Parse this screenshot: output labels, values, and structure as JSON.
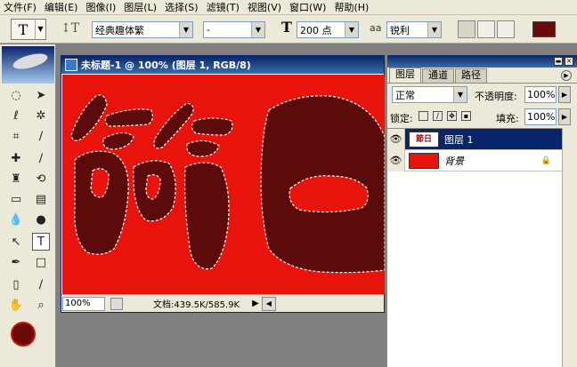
{
  "menu": [
    "文件(F)",
    "编辑(E)",
    "图像(I)",
    "图层(L)",
    "选择(S)",
    "滤镜(T)",
    "视图(V)",
    "窗口(W)",
    "帮助(H)"
  ],
  "options": {
    "font_family": "经典趣体繁",
    "font_style": "-",
    "font_size": "200 点",
    "antialias_icon": "aa",
    "antialias": "锐利",
    "text_color": "#6b0a0a"
  },
  "document": {
    "title": "未标题-1 @ 100% (图层 1, RGB/8)",
    "zoom": "100%",
    "doc_info": "文档:439.5K/585.9K",
    "canvas_bg": "#e8140c",
    "glyph_color": "#5c0a0a"
  },
  "layers_palette": {
    "tabs": [
      "图层",
      "通道",
      "路径"
    ],
    "blend_mode": "正常",
    "opacity_label": "不透明度:",
    "opacity": "100%",
    "lock_label": "锁定:",
    "fill_label": "填充:",
    "fill": "100%",
    "layers": [
      {
        "name": "图层 1",
        "thumb_text": "節日",
        "selected": true
      },
      {
        "name": "背景",
        "selected": false
      }
    ]
  },
  "colors": {
    "foreground": "#6b0a0a",
    "background": "#ffffff"
  }
}
